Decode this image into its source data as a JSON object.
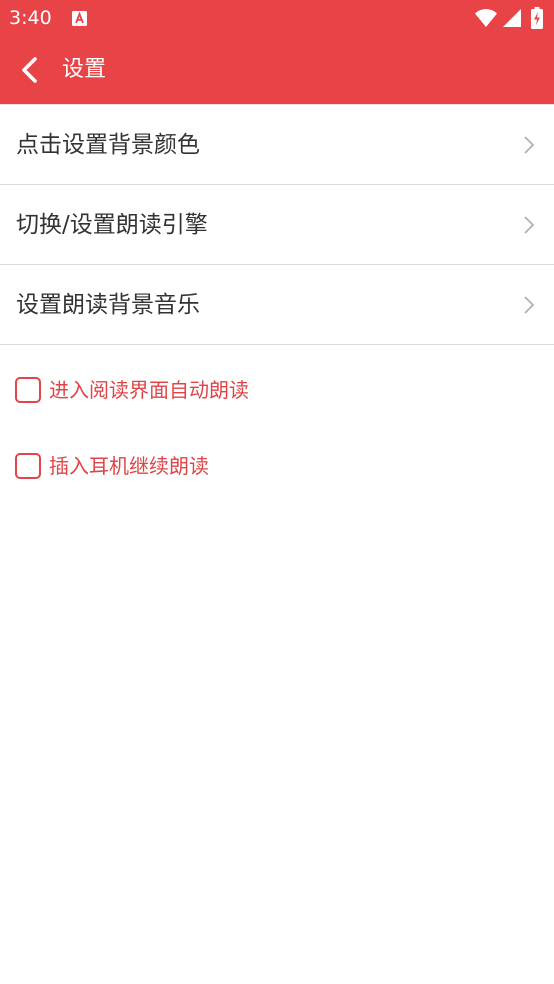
{
  "colors": {
    "accent": "#e84346",
    "checkbox_text": "#df4548",
    "item_text": "#333333",
    "divider": "#dcdcdc",
    "chevron": "#b0b0b0"
  },
  "status_bar": {
    "time": "3:40",
    "icons": [
      "notification-a-icon",
      "wifi-icon",
      "signal-icon",
      "battery-charging-icon"
    ]
  },
  "app_bar": {
    "back_icon": "chevron-left-icon",
    "title": "设置"
  },
  "settings": {
    "items": [
      {
        "label": "点击设置背景颜色"
      },
      {
        "label": "切换/设置朗读引擎"
      },
      {
        "label": "设置朗读背景音乐"
      }
    ],
    "checkboxes": [
      {
        "label": "进入阅读界面自动朗读",
        "checked": false
      },
      {
        "label": "插入耳机继续朗读",
        "checked": false
      }
    ]
  }
}
